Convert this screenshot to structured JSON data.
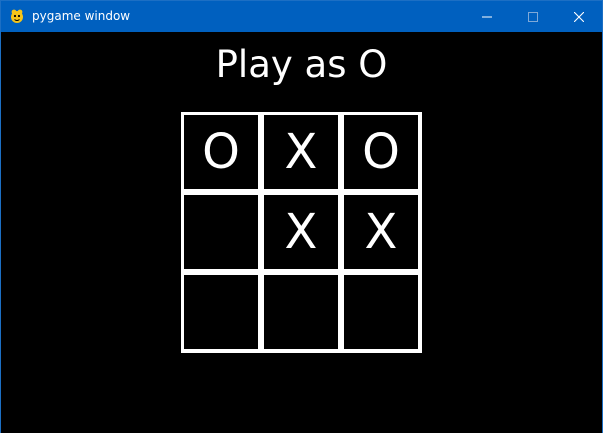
{
  "window": {
    "title": "pygame window",
    "app_icon": "pygame-snake-icon",
    "titlebar_color": "#0060bf"
  },
  "game": {
    "title": "Play as O",
    "board": [
      [
        "O",
        "X",
        "O"
      ],
      [
        "",
        "X",
        "X"
      ],
      [
        "",
        "",
        ""
      ]
    ]
  }
}
